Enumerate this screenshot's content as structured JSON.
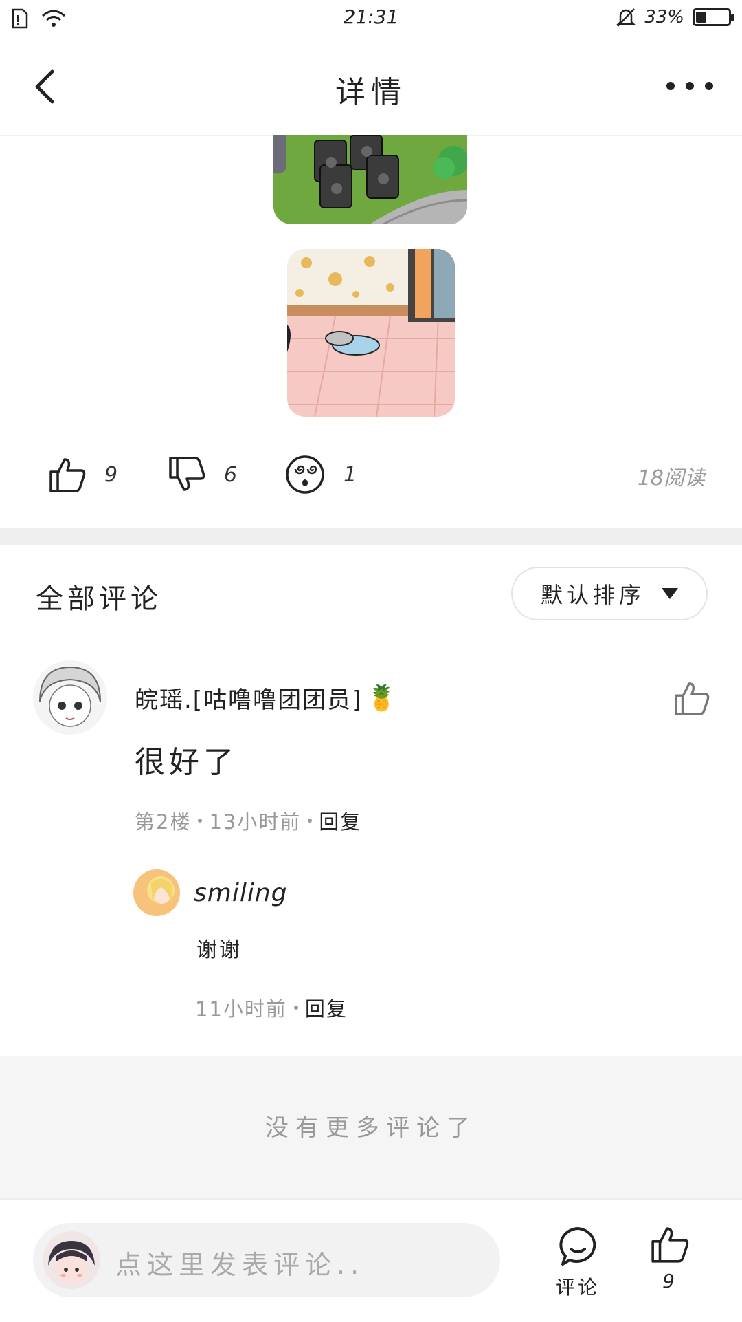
{
  "status_bar": {
    "time": "21:31",
    "battery": "33%",
    "battery_level": 0.33,
    "icons": [
      "sim-icon",
      "wifi-icon",
      "silent-bell-icon",
      "battery-icon"
    ]
  },
  "nav": {
    "title": "详情",
    "back_icon": "back-arrow-icon",
    "more_icon": "more-dots-icon"
  },
  "reactions": {
    "like_count": "9",
    "dislike_count": "6",
    "dizzy_count": "1",
    "reads": "18阅读"
  },
  "comments_section": {
    "title": "全部评论",
    "sort_label": "默认排序"
  },
  "comment": {
    "username": "皖瑶.[咕噜噜团团员]",
    "badge": "🍍",
    "text": "很好了",
    "floor": "第2楼",
    "time": "13小时前",
    "reply_label": "回复"
  },
  "reply": {
    "username": "smiling",
    "text": "谢谢",
    "time": "11小时前",
    "reply_label": "回复"
  },
  "no_more": "没有更多评论了",
  "bottom_bar": {
    "input_placeholder": "点这里发表评论..",
    "comment_label": "评论",
    "like_count": "9"
  }
}
